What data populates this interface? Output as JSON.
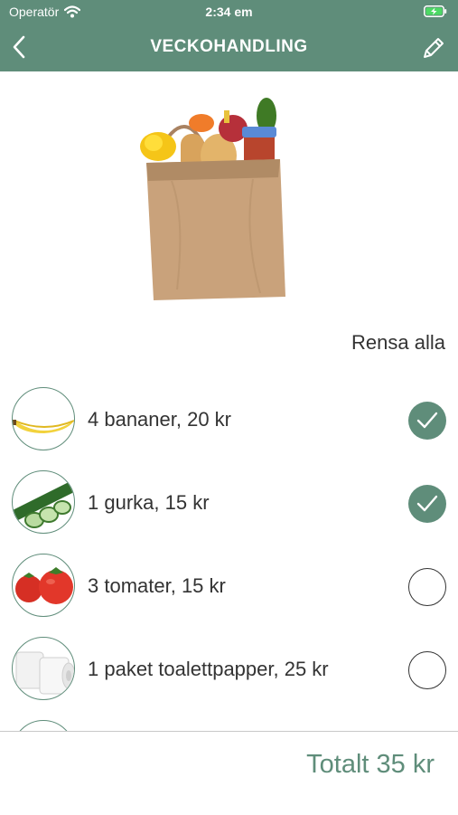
{
  "status_bar": {
    "carrier": "Operatör",
    "time": "2:34 em",
    "wifi_icon": "wifi-icon",
    "battery_icon": "battery-charging-icon"
  },
  "nav": {
    "title": "VECKOHANDLING",
    "back_icon": "chevron-left-icon",
    "edit_icon": "pencil-icon"
  },
  "hero_image": "grocery-bag-image",
  "clear_all_label": "Rensa alla",
  "items": [
    {
      "label": "4 bananer, 20 kr",
      "image": "banana",
      "checked": true
    },
    {
      "label": "1 gurka, 15 kr",
      "image": "cucumber",
      "checked": true
    },
    {
      "label": "3 tomater, 15 kr",
      "image": "tomatoes",
      "checked": false
    },
    {
      "label": "1 paket toalettpapper, 25 kr",
      "image": "toilet-paper",
      "checked": false
    }
  ],
  "total_label": "Totalt 35 kr",
  "colors": {
    "accent": "#5f8d7a",
    "text": "#333333",
    "background": "#ffffff"
  }
}
